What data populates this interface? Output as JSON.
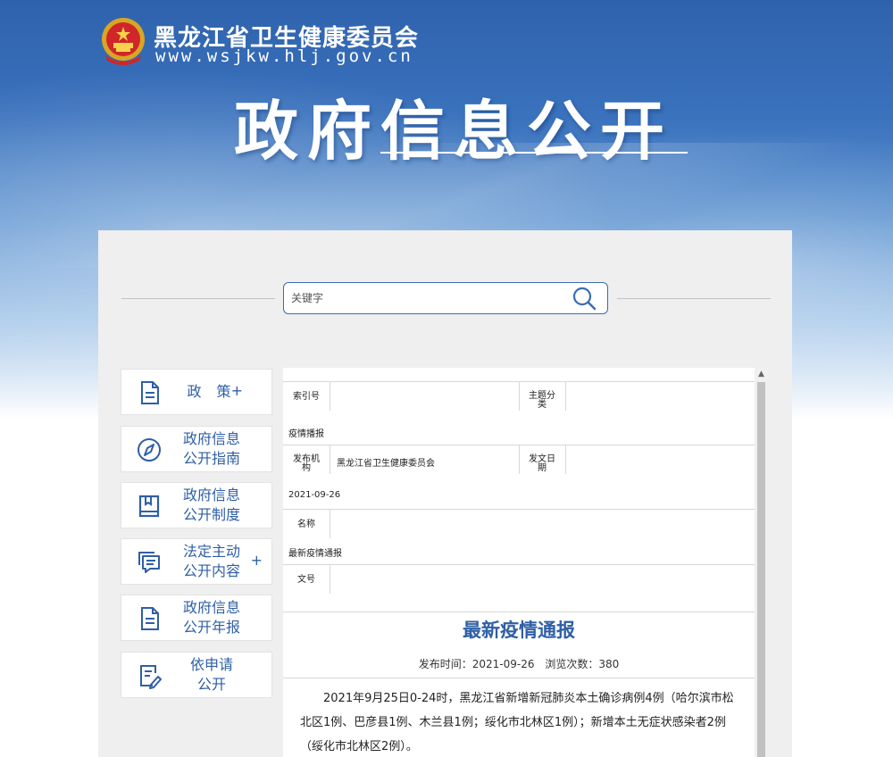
{
  "header": {
    "org_name": "黑龙江省卫生健康委员会",
    "org_url": "www.wsjkw.hlj.gov.cn",
    "banner_title": "政府信息公开"
  },
  "search": {
    "placeholder": "关键字"
  },
  "sidebar": {
    "items": [
      {
        "label": "政 策",
        "line1": "",
        "line2": "",
        "plus": "+",
        "icon": "document-icon"
      },
      {
        "label": "",
        "line1": "政府信息",
        "line2": "公开指南",
        "plus": "",
        "icon": "compass-icon"
      },
      {
        "label": "",
        "line1": "政府信息",
        "line2": "公开制度",
        "plus": "",
        "icon": "book-icon"
      },
      {
        "label": "",
        "line1": "法定主动",
        "line2": "公开内容",
        "plus": "+",
        "icon": "message-list-icon"
      },
      {
        "label": "",
        "line1": "政府信息",
        "line2": "公开年报",
        "plus": "",
        "icon": "report-icon"
      },
      {
        "label": "",
        "line1": "依申请",
        "line2": "公开",
        "plus": "",
        "icon": "edit-document-icon"
      }
    ]
  },
  "meta": {
    "index_label": "索引号",
    "index_value": "",
    "topic_label_1": "主题分",
    "topic_label_2": "类",
    "topic_value": "疫情播报",
    "publisher_label_1": "发布机",
    "publisher_label_2": "构",
    "publisher_value": "黑龙江省卫生健康委员会",
    "date_label_1": "发文日",
    "date_label_2": "期",
    "date_value": "2021-09-26",
    "name_label": "名称",
    "name_value": "最新疫情通报",
    "docno_label": "文号",
    "docno_value": ""
  },
  "article": {
    "title": "最新疫情通报",
    "publish_time": "发布时间：2021-09-26",
    "views": "浏览次数：380",
    "body": "2021年9月25日0-24时，黑龙江省新增新冠肺炎本土确诊病例4例（哈尔滨市松北区1例、巴彦县1例、木兰县1例；绥化市北林区1例）；新增本土无症状感染者2例（绥化市北林区2例）。"
  },
  "colors": {
    "brand_blue": "#2f5fa5",
    "search_border": "#3b6cb3"
  }
}
